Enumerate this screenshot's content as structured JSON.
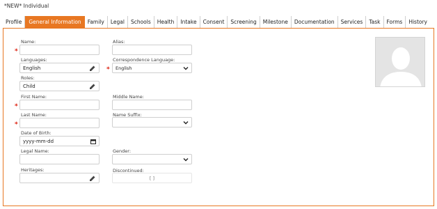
{
  "page": {
    "title": "*NEW* Individual"
  },
  "tabs": [
    {
      "label": "Profile"
    },
    {
      "label": "General Information"
    },
    {
      "label": "Family"
    },
    {
      "label": "Legal"
    },
    {
      "label": "Schools"
    },
    {
      "label": "Health"
    },
    {
      "label": "Intake"
    },
    {
      "label": "Consent"
    },
    {
      "label": "Screening"
    },
    {
      "label": "Milestone"
    },
    {
      "label": "Documentation"
    },
    {
      "label": "Services"
    },
    {
      "label": "Task"
    },
    {
      "label": "Forms"
    },
    {
      "label": "History"
    }
  ],
  "active_tab": "General Information",
  "form": {
    "name": {
      "label": "Name:",
      "value": ""
    },
    "alias": {
      "label": "Alias:",
      "value": ""
    },
    "languages": {
      "label": "Languages:",
      "value": "English"
    },
    "correspondence_language": {
      "label": "Correspondence Language:",
      "value": "English"
    },
    "roles": {
      "label": "Roles:",
      "value": "Child"
    },
    "first_name": {
      "label": "First Name:",
      "value": ""
    },
    "middle_name": {
      "label": "Middle Name:",
      "value": ""
    },
    "last_name": {
      "label": "Last Name:",
      "value": ""
    },
    "name_suffix": {
      "label": "Name Suffix:",
      "value": ""
    },
    "date_of_birth": {
      "label": "Date of Birth:",
      "placeholder": "yyyy-mm-dd"
    },
    "legal_name": {
      "label": "Legal Name:",
      "value": ""
    },
    "gender": {
      "label": "Gender:",
      "value": ""
    },
    "heritages": {
      "label": "Heritages:",
      "value": ""
    },
    "discontinued": {
      "label": "Discontinued:",
      "value": "[ ]"
    }
  },
  "required_marker": "*",
  "colors": {
    "accent": "#e87722",
    "required": "#dd2211",
    "border": "#cfcfcf"
  },
  "icons": {
    "edit": "pencil-icon",
    "dropdown": "chevron-down-icon",
    "calendar": "calendar-icon",
    "avatar": "avatar-placeholder-icon"
  }
}
